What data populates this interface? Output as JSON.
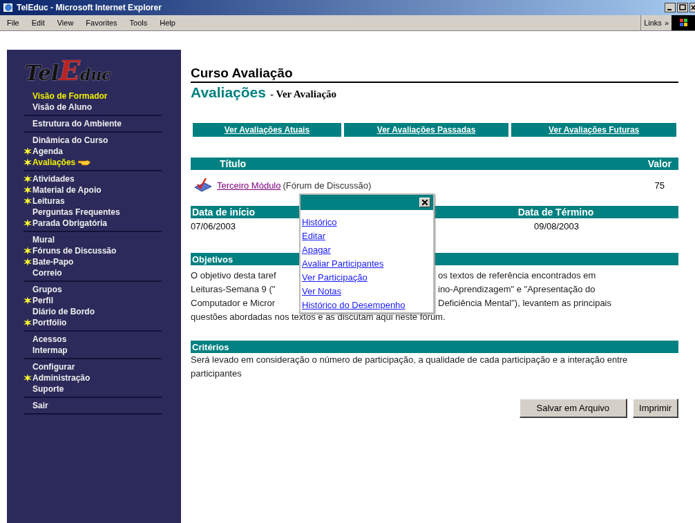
{
  "window": {
    "title": "TelEduc - Microsoft Internet Explorer"
  },
  "menu_bar": {
    "items": [
      "File",
      "Edit",
      "View",
      "Favorites",
      "Tools",
      "Help"
    ],
    "links_label": "Links",
    "links_more": "»"
  },
  "sidebar": {
    "logo": [
      {
        "text": "Tel",
        "kind": "plain"
      },
      {
        "text": "E",
        "kind": "big"
      },
      {
        "text": "duc",
        "kind": "small"
      }
    ],
    "groups": [
      {
        "items": [
          {
            "label": "Visão de Formador",
            "star": false,
            "highlighted": true,
            "current": false
          },
          {
            "label": "Visão de Aluno",
            "star": false,
            "highlighted": false,
            "current": false
          }
        ]
      },
      {
        "items": [
          {
            "label": "Estrutura do Ambiente",
            "star": false,
            "highlighted": false,
            "current": false
          }
        ]
      },
      {
        "items": [
          {
            "label": "Dinâmica do Curso",
            "star": false,
            "highlighted": false,
            "current": false
          },
          {
            "label": "Agenda",
            "star": true,
            "highlighted": false,
            "current": false
          },
          {
            "label": "Avaliações",
            "star": true,
            "highlighted": true,
            "current": true
          }
        ]
      },
      {
        "items": [
          {
            "label": "Atividades",
            "star": true,
            "highlighted": false,
            "current": false
          },
          {
            "label": "Material de Apoio",
            "star": true,
            "highlighted": false,
            "current": false
          },
          {
            "label": "Leituras",
            "star": true,
            "highlighted": false,
            "current": false
          },
          {
            "label": "Perguntas Frequentes",
            "star": false,
            "highlighted": false,
            "current": false
          },
          {
            "label": "Parada Obrigatória",
            "star": true,
            "highlighted": false,
            "current": false
          }
        ]
      },
      {
        "items": [
          {
            "label": "Mural",
            "star": false,
            "highlighted": false,
            "current": false
          },
          {
            "label": "Fóruns de Discussão",
            "star": true,
            "highlighted": false,
            "current": false
          },
          {
            "label": "Bate-Papo",
            "star": true,
            "highlighted": false,
            "current": false
          },
          {
            "label": "Correio",
            "star": false,
            "highlighted": false,
            "current": false
          }
        ]
      },
      {
        "items": [
          {
            "label": "Grupos",
            "star": false,
            "highlighted": false,
            "current": false
          },
          {
            "label": "Perfil",
            "star": true,
            "highlighted": false,
            "current": false
          },
          {
            "label": "Diário de Bordo",
            "star": false,
            "highlighted": false,
            "current": false
          },
          {
            "label": "Portfólio",
            "star": true,
            "highlighted": false,
            "current": false
          }
        ]
      },
      {
        "items": [
          {
            "label": "Acessos",
            "star": false,
            "highlighted": false,
            "current": false
          },
          {
            "label": "Intermap",
            "star": false,
            "highlighted": false,
            "current": false
          }
        ]
      },
      {
        "items": [
          {
            "label": "Configurar",
            "star": false,
            "highlighted": false,
            "current": false
          },
          {
            "label": "Administração",
            "star": true,
            "highlighted": false,
            "current": false
          },
          {
            "label": "Suporte",
            "star": false,
            "highlighted": false,
            "current": false
          }
        ]
      },
      {
        "items": [
          {
            "label": "Sair",
            "star": false,
            "highlighted": false,
            "current": false
          }
        ]
      }
    ]
  },
  "content": {
    "course_title": "Curso Avaliação",
    "section_title": "Avaliações",
    "section_subtitle": "- Ver Avaliação",
    "nav_links": [
      "Ver Avaliações Atuais",
      "Ver Avaliações Passadas",
      "Ver Avaliações Futuras"
    ],
    "table": {
      "columns": [
        "Título",
        "Valor"
      ],
      "row": {
        "title": "Terceiro Módulo",
        "type": "(Fórum de Discussão)",
        "value": "75"
      }
    },
    "dates": {
      "columns": [
        "Data de início",
        "Data de Término"
      ],
      "values": [
        "07/06/2003",
        "09/08/2003"
      ]
    },
    "objectives": {
      "heading": "Objetivos",
      "lines": [
        {
          "left": "O objetivo desta taref",
          "right": "os textos de referência encontrados em"
        },
        {
          "left": "Leituras-Semana 9 (\"",
          "right": "ino-Aprendizagem\" e \"Apresentação do"
        },
        {
          "left": "Computador e Micror",
          "right": "Deficiência Mental\"), levantem as principais"
        },
        {
          "left": "questões abordadas nos textos e as discutam aqui neste fórum."
        }
      ]
    },
    "criteria": {
      "heading": "Critérios",
      "text": "Será levado em consideração o número de participação, a qualidade de cada participação e a interação entre participantes"
    },
    "buttons": [
      "Salvar em Arquivo",
      "Imprimir"
    ],
    "popup": {
      "items": [
        "Histórico",
        "Editar",
        "Apagar",
        "Avaliar Participantes",
        "Ver Participação",
        "Ver Notas",
        "Histórico do Desempenho"
      ]
    }
  }
}
